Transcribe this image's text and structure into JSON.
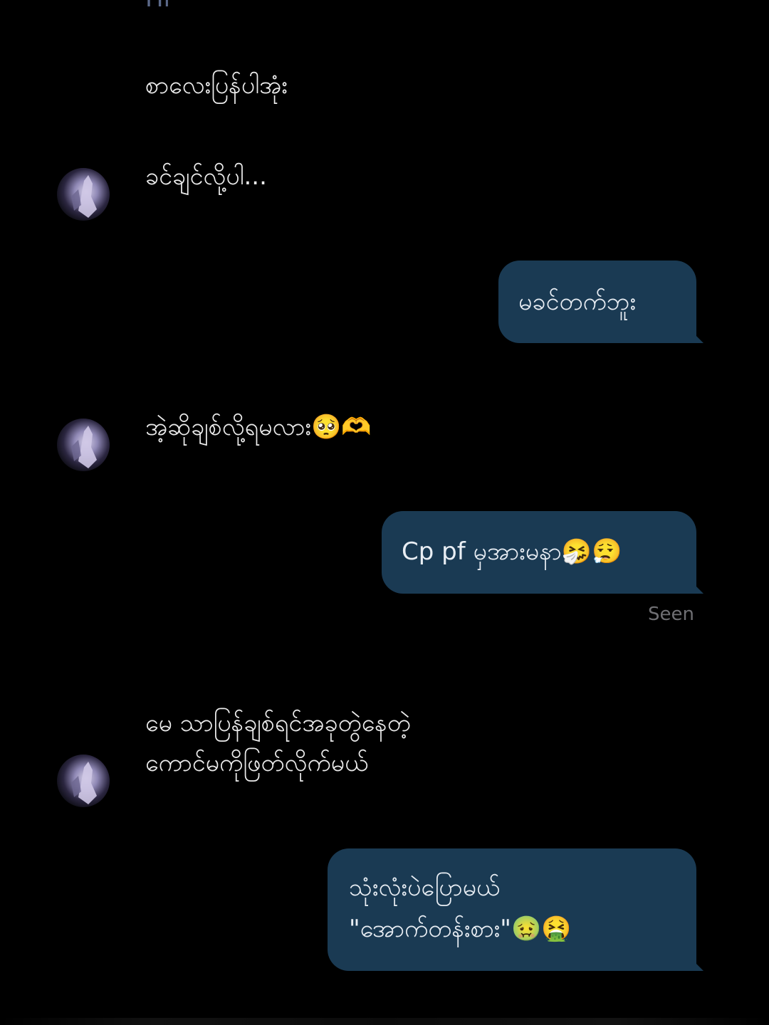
{
  "top_fragment": "Hi",
  "messages": [
    {
      "side": "in",
      "text": "စာလေးပြန်ပါအုံး"
    },
    {
      "side": "in",
      "text": "ခင်ချင်လို့ပါ...",
      "avatar": "avatar-icon"
    },
    {
      "side": "out",
      "text": "မခင်တက်ဘူး"
    },
    {
      "side": "in",
      "text": "အဲ့ဆိုချစ်လို့ရမလား🥺🫶",
      "avatar": "avatar-icon"
    },
    {
      "side": "out",
      "text": "Cp  pf မှအားမနာ🤧😮‍💨"
    },
    {
      "side": "in",
      "text": "မေ သာပြန်ချစ်ရင်အခုတွဲနေတဲ့\nကောင်မကိုဖြတ်လိုက်မယ်",
      "avatar": "avatar-icon"
    },
    {
      "side": "out",
      "text": "သုံးလုံးပဲပြောမယ်\n     \"အောက်တန်းစား\"🤢🤮"
    }
  ],
  "status": {
    "seen_label": "Seen"
  },
  "colors": {
    "background": "#000000",
    "outgoing_bubble": "#1a3a53",
    "text": "#ececec"
  }
}
